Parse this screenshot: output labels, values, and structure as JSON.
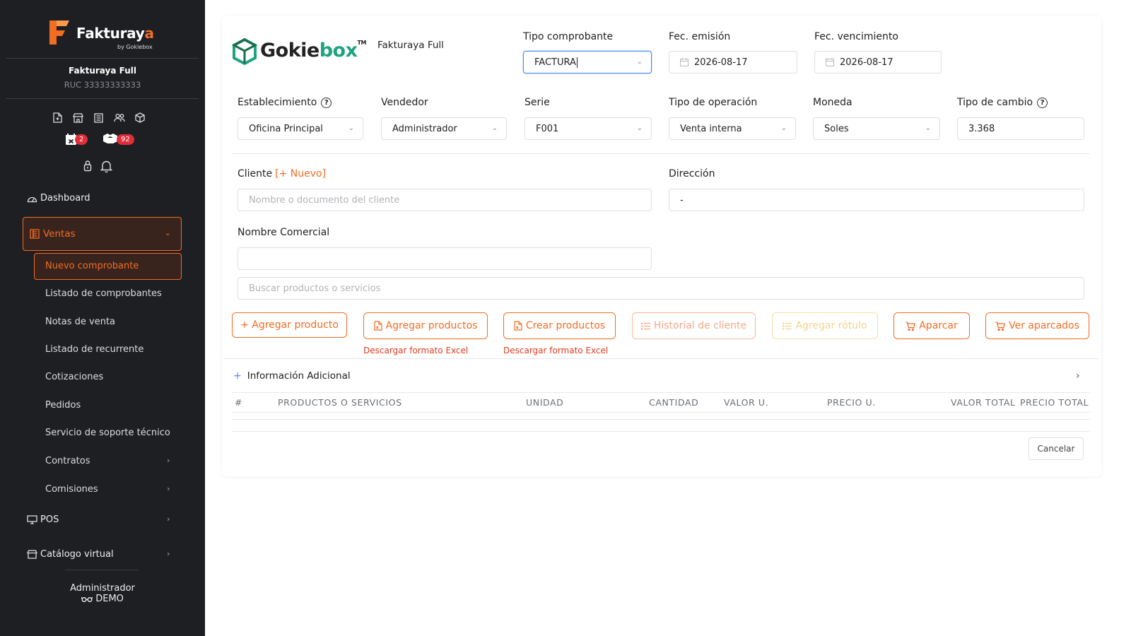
{
  "brand": {
    "app_name_prefix": "Fakturay",
    "app_name_suffix": "a",
    "app_sub": "by Gokiebox",
    "company_logo_prefix": "Gokie",
    "company_logo_suffix": "box",
    "company_logo_tm": "TM",
    "accent_color": "#f36c24",
    "logo_green": "#1fa37f"
  },
  "sidebar": {
    "company_name": "Fakturaya Full",
    "company_ruc": "RUC 33333333333",
    "badges": {
      "calendar_count": "2",
      "box_count": "92"
    },
    "nav": {
      "dashboard": "Dashboard",
      "ventas": "Ventas",
      "pos": "POS",
      "catalogo": "Catálogo virtual"
    },
    "ventas_items": [
      "Nuevo comprobante",
      "Listado de comprobantes",
      "Notas de venta",
      "Listado de recurrente",
      "Cotizaciones",
      "Pedidos",
      "Servicio de soporte técnico",
      "Contratos",
      "Comisiones"
    ],
    "user": {
      "name": "Administrador",
      "role": "DEMO"
    }
  },
  "header": {
    "plan_name": "Fakturaya Full",
    "tipo_comprobante": {
      "label": "Tipo comprobante",
      "value": "FACTURA"
    },
    "fec_emision": {
      "label": "Fec. emisión",
      "value": "2026-08-17"
    },
    "fec_vencimiento": {
      "label": "Fec. vencimiento",
      "value": "2026-08-17"
    }
  },
  "form": {
    "establecimiento": {
      "label": "Establecimiento",
      "value": "Oficina Principal"
    },
    "vendedor": {
      "label": "Vendedor",
      "value": "Administrador"
    },
    "serie": {
      "label": "Serie",
      "value": "F001"
    },
    "tipo_operacion": {
      "label": "Tipo de operación",
      "value": "Venta interna"
    },
    "moneda": {
      "label": "Moneda",
      "value": "Soles"
    },
    "tipo_cambio": {
      "label": "Tipo de cambio",
      "value": "3.368"
    },
    "cliente": {
      "label": "Cliente",
      "new_link": "[+ Nuevo]",
      "placeholder": "Nombre o documento del cliente"
    },
    "direccion": {
      "label": "Dirección",
      "value": "-"
    },
    "nombre_comercial": {
      "label": "Nombre Comercial",
      "value": ""
    },
    "buscar": {
      "placeholder": "Buscar productos o servicios"
    }
  },
  "actions": {
    "agregar_producto": "+ Agregar producto",
    "agregar_productos": "Agregar productos",
    "crear_productos": "Crear productos",
    "historial_cliente": "Historial de cliente",
    "agregar_rotulo": "Agregar rótulo",
    "aparcar": "Aparcar",
    "ver_aparcados": "Ver aparcados",
    "descargar_excel_1": "Descargar formato Excel",
    "descargar_excel_2": "Descargar formato Excel"
  },
  "info_adicional": "Información Adicional",
  "table": {
    "columns": [
      "#",
      "PRODUCTOS O SERVICIOS",
      "UNIDAD",
      "CANTIDAD",
      "VALOR U.",
      "PRECIO U.",
      "VALOR TOTAL",
      "PRECIO TOTAL"
    ]
  },
  "footer": {
    "cancel": "Cancelar"
  }
}
